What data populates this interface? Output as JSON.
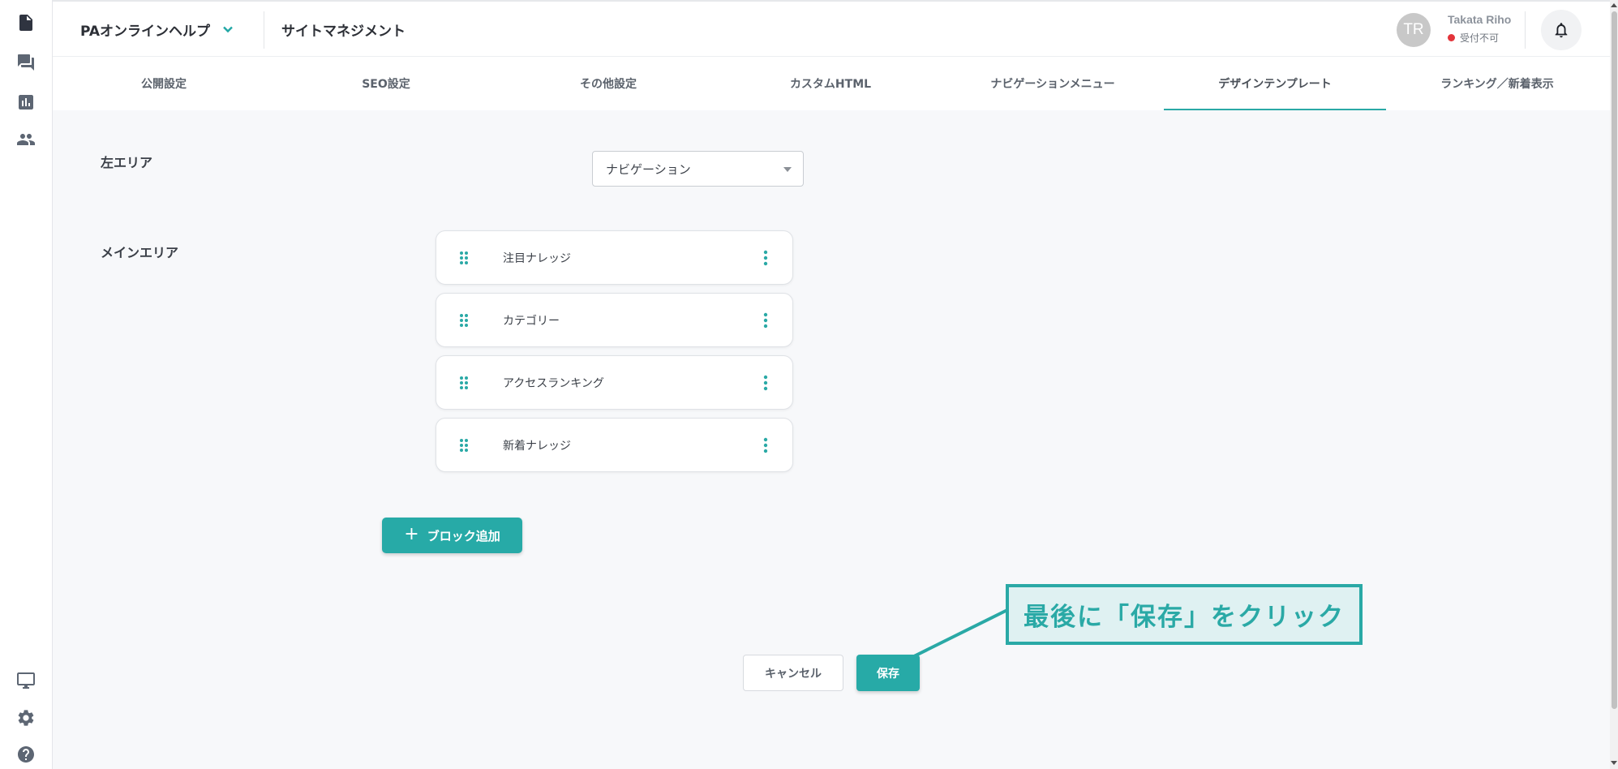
{
  "header": {
    "site_name": "PAオンラインヘルプ",
    "page_title": "サイトマネジメント",
    "user": {
      "initials": "TR",
      "name": "Takata Riho",
      "status": "受付不可"
    }
  },
  "rail": {
    "icons": [
      "document-icon",
      "chat-icon",
      "chart-icon",
      "people-icon",
      "monitor-icon",
      "gear-icon",
      "help-icon"
    ]
  },
  "tabs": [
    {
      "label": "公開設定"
    },
    {
      "label": "SEO設定"
    },
    {
      "label": "その他設定"
    },
    {
      "label": "カスタムHTML"
    },
    {
      "label": "ナビゲーションメニュー"
    },
    {
      "label": "デザインテンプレート",
      "active": true
    },
    {
      "label": "ランキング／新着表示"
    }
  ],
  "left_area": {
    "label": "左エリア",
    "selected": "ナビゲーション"
  },
  "main_area": {
    "label": "メインエリア",
    "blocks": [
      {
        "label": "注目ナレッジ"
      },
      {
        "label": "カテゴリー"
      },
      {
        "label": "アクセスランキング"
      },
      {
        "label": "新着ナレッジ"
      }
    ],
    "add_label": "ブロック追加"
  },
  "callout": {
    "text": "最後に「保存」をクリック"
  },
  "footer": {
    "cancel_label": "キャンセル",
    "save_label": "保存"
  },
  "colors": {
    "accent": "#27aaa7",
    "status_red": "#e3343b"
  }
}
